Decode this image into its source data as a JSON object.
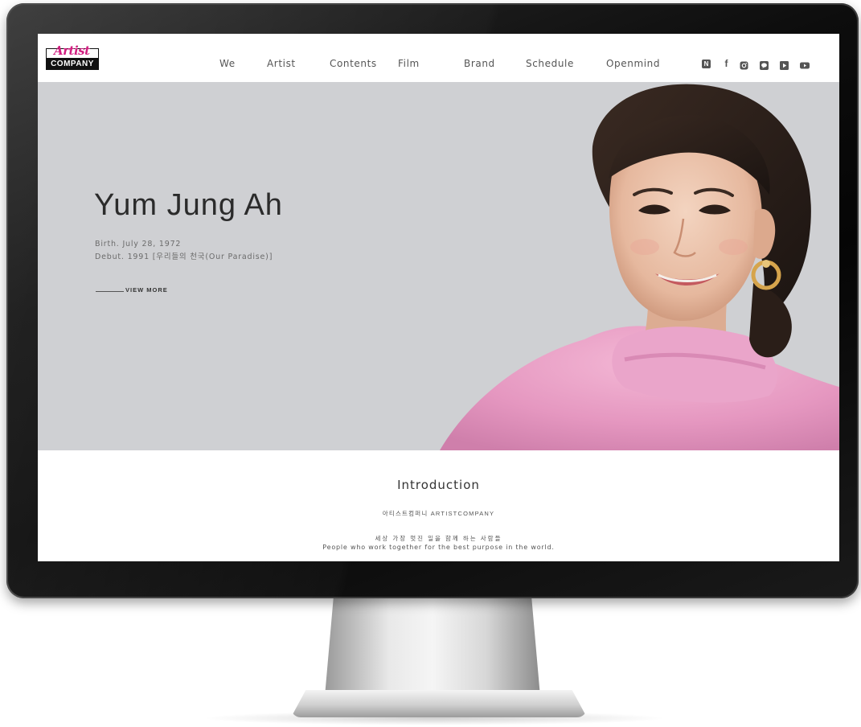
{
  "logo": {
    "script": "Artist",
    "wordmark": "COMPANY"
  },
  "nav": {
    "items": [
      {
        "label": "We"
      },
      {
        "label": "Artist"
      },
      {
        "label": "Contents"
      },
      {
        "label": "Film"
      },
      {
        "label": "Brand"
      },
      {
        "label": "Schedule"
      },
      {
        "label": "Openmind"
      }
    ]
  },
  "social": {
    "icons": [
      "naver-icon",
      "facebook-icon",
      "instagram-icon",
      "kakao-icon",
      "play-icon",
      "youtube-icon"
    ],
    "naver_glyph": "N",
    "facebook_glyph": "f"
  },
  "hero": {
    "name": "Yum Jung Ah",
    "birth": "Birth. July 28, 1972",
    "debut": "Debut. 1991 [우리들의 천국(Our Paradise)]",
    "cta": "VIEW MORE",
    "background": "#cfd0d3"
  },
  "intro": {
    "title": "Introduction",
    "company": "아티스트컴퍼니 ARTISTCOMPANY",
    "slogan_ko": "세상 가장 멋진 일을 함께 하는 사람들",
    "slogan_en": "People who work together for the best purpose in the world."
  },
  "colors": {
    "brand_pink": "#d11f80",
    "text_dark": "#2b2b2b",
    "text_muted": "#555555"
  }
}
